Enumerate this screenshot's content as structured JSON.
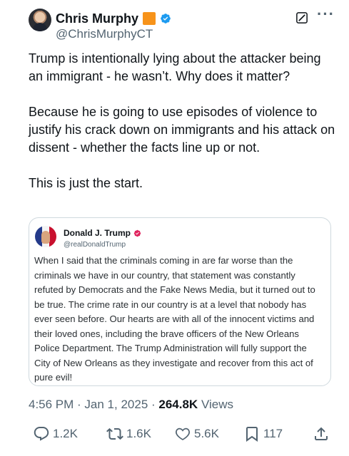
{
  "author": {
    "name": "Chris Murphy",
    "handle": "@ChrisMurphyCT"
  },
  "body": {
    "p1": "Trump is intentionally lying about the attacker being an immigrant - he wasn’t. Why does it matter?",
    "p2": "Because he is going to use episodes of violence to justify his crack down on immigrants and his attack on dissent - whether the facts line up or not.",
    "p3": "This is just the start."
  },
  "quoted": {
    "name": "Donald J. Trump",
    "handle": "@realDonaldTrump",
    "text": "When I said that the criminals coming in are far worse than the criminals we have in our country, that statement was constantly refuted by Democrats and the Fake News Media, but it turned out to be true. The crime rate in our country is at a level that nobody has ever seen before. Our hearts are with all of the innocent victims and their loved ones, including the brave officers of the New Orleans Police Department. The Trump Administration will fully support the City of New Orleans as they investigate and recover from this act of pure evil!"
  },
  "meta": {
    "time": "4:56 PM",
    "sep1": " · ",
    "date": "Jan 1, 2025",
    "sep2": " · ",
    "views_count": "264.8K",
    "views_label": " Views"
  },
  "actions": {
    "replies": "1.2K",
    "reposts": "1.6K",
    "likes": "5.6K",
    "bookmarks": "117"
  },
  "colors": {
    "verified": "#1d9bf0",
    "orange_badge": "#f7931a",
    "pink_badge": "#e0245e",
    "muted": "#536471",
    "text": "#0f1419"
  },
  "icons": {
    "verified": "verified-badge-icon",
    "grok": "grok-icon",
    "more": "more-options-icon",
    "reply": "reply-icon",
    "repost": "repost-icon",
    "like": "heart-icon",
    "bookmark": "bookmark-icon",
    "share": "share-icon"
  }
}
